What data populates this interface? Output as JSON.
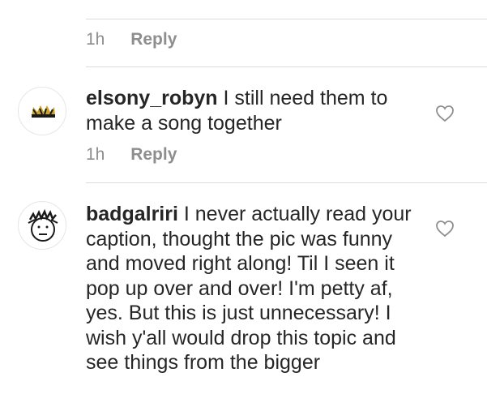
{
  "previous_comment": {
    "time": "1h",
    "reply_label": "Reply"
  },
  "comments": [
    {
      "username": "elsony_robyn",
      "text": "I still need them to make a song together",
      "time": "1h",
      "reply_label": "Reply",
      "avatar_icon": "crown-icon",
      "like_icon": "heart-outline-icon"
    },
    {
      "username": "badgalriri",
      "text": "I never actually read your caption, thought the pic was funny and moved right along! Til I seen it pop up over and over! I'm petty af, yes. But this is just unnecessary! I wish y'all would drop this topic and see things from the bigger",
      "avatar_icon": "cartoon-face-icon",
      "like_icon": "heart-outline-icon"
    }
  ],
  "colors": {
    "text": "#262626",
    "meta": "#8e8e8e",
    "divider": "#dbdbdb",
    "crown": "#c9a227"
  }
}
